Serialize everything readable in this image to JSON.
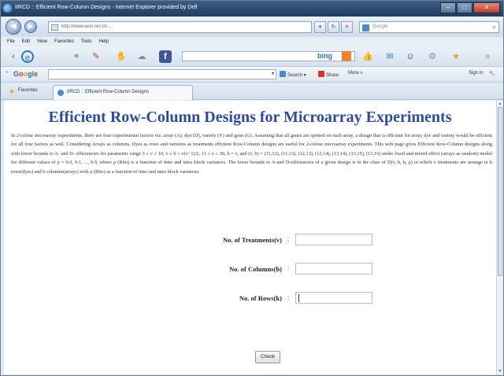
{
  "window": {
    "title": "IIRCD :: Efficient Row-Column Designs - Internet Explorer provided by Dell"
  },
  "address": {
    "url": "http://www.iasri.res.in/..."
  },
  "search": {
    "placeholder": "Google"
  },
  "menu": [
    "File",
    "Edit",
    "View",
    "Favorites",
    "Tools",
    "Help"
  ],
  "toolbar": {
    "bing_label": "bing"
  },
  "google_bar": {
    "logo": [
      "G",
      "o",
      "o",
      "g",
      "l",
      "e"
    ],
    "search_btn": "Search",
    "share_btn": "Share",
    "more_btn": "More »",
    "signin": "Sign In"
  },
  "favorites": {
    "label": "Favorites",
    "tab_title": "IIRCD :: Efficient Row-Column Designs"
  },
  "page": {
    "title": "Efficient Row-Column Designs for Microarray Experiments",
    "intro": "In 2-colour microarray experiments, there are four experimental factors viz. array (A), dye (D), variety (V) and gene (G). Assuming that all genes are spotted on each array, a design that is efficient for array, dye and variety would be efficient for all four factors as well. Considering Arrays as columns, Dyes as rows and varieties as treatments efficient Row-Column designs are useful for 2-colour microarray experiments. This web page gives Efficient Row-Column designs along with lower bounds to A- and D- efficiencies for parametric range 3 ≤ v ≤ 10, v ≤ b ≤ v(v−1)/2, 11 ≤ v ≤ 30, b = v, and (v, b) = (11,12), (11,13), (12,13), (12,14), (13,14), (13,15), (13,16) under fixed and mixed effect (arrays as random) model for different values of ρ = 0.0, 0.1, ..., 0.9, where ρ (Rho) is a function of inter and intra block variances. The lower bounds to A-and D-efficiencies of a given design is in the class of D(v, b, k, ρ) in which v treatments are arrange in k rows(dyes) and b columns(arrays) with ρ (Rho) as a function of inter and intra block variances.",
    "form": {
      "treatments_label": "No. of Treatments(v)",
      "columns_label": "No. of Columns(b)",
      "rows_label": "No. of Rows(k)",
      "colon": ":",
      "check_label": "Check"
    }
  }
}
